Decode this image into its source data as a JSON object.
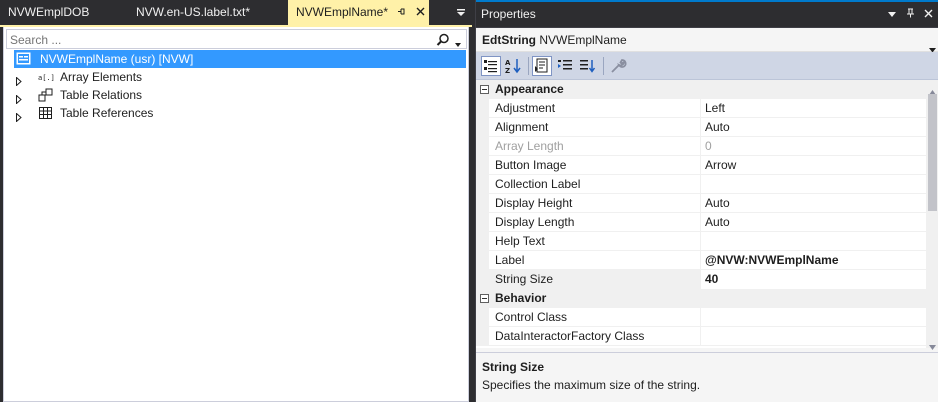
{
  "tabs": [
    {
      "label": "NVWEmplDOB"
    },
    {
      "label": "NVW.en-US.label.txt*"
    },
    {
      "label": "NVWEmplName*"
    }
  ],
  "explorer": {
    "search_placeholder": "Search ...",
    "root": {
      "label": "NVWEmplName (usr) [NVW]",
      "icon": "edt-icon"
    },
    "children": [
      {
        "label": "Array Elements",
        "icon": "array-elements-icon"
      },
      {
        "label": "Table Relations",
        "icon": "table-relations-icon"
      },
      {
        "label": "Table References",
        "icon": "table-references-icon"
      }
    ]
  },
  "properties": {
    "title": "Properties",
    "object_type": "EdtString",
    "object_name": "NVWEmplName",
    "categories": [
      {
        "name": "Appearance",
        "rows": [
          {
            "name": "Adjustment",
            "value": "Left"
          },
          {
            "name": "Alignment",
            "value": "Auto"
          },
          {
            "name": "Array Length",
            "value": "0"
          },
          {
            "name": "Button Image",
            "value": "Arrow"
          },
          {
            "name": "Collection Label",
            "value": ""
          },
          {
            "name": "Display Height",
            "value": "Auto"
          },
          {
            "name": "Display Length",
            "value": "Auto"
          },
          {
            "name": "Help Text",
            "value": ""
          },
          {
            "name": "Label",
            "value": "@NVW:NVWEmplName"
          },
          {
            "name": "String Size",
            "value": "40"
          }
        ]
      },
      {
        "name": "Behavior",
        "rows": [
          {
            "name": "Control Class",
            "value": ""
          },
          {
            "name": "DataInteractorFactory Class",
            "value": ""
          }
        ]
      }
    ],
    "description": {
      "title": "String Size",
      "text": "Specifies the maximum size of the string."
    }
  },
  "colors": {
    "active_tab": "#fff1a8",
    "selection": "#3399ff",
    "chrome_dark": "#2d2d30",
    "accent": "#007acc"
  }
}
